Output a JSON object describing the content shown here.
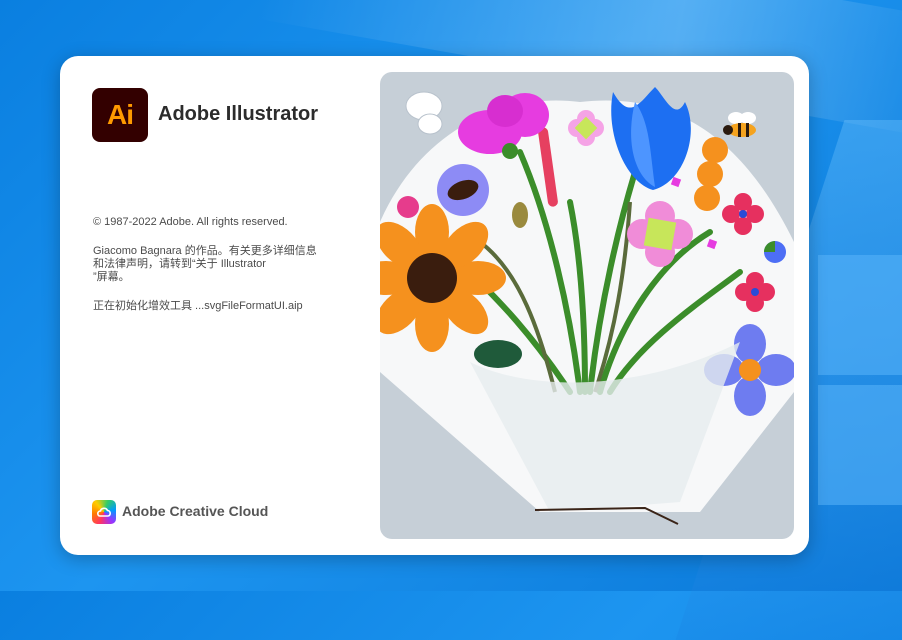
{
  "splash": {
    "app_logo_text": "Ai",
    "app_name": "Adobe Illustrator",
    "copyright": "© 1987-2022 Adobe. All rights reserved.",
    "legal_notice": "Giacomo  Bagnara 的作品。有关更多详细信息\n和法律声明，请转到“关于 Illustrator\n”屏幕。",
    "status": "正在初始化增效工具 ...svgFileFormatUI.aip",
    "footer_brand": "Adobe Creative Cloud"
  },
  "colors": {
    "app_logo_bg": "#330000",
    "app_logo_text": "#FF9A00",
    "desktop_bg": "#0A7FE0",
    "artwork_bg": "#C6CFD7"
  },
  "icons": [
    "illustrator-logo-icon",
    "creative-cloud-icon",
    "flower-bouquet-illustration"
  ]
}
